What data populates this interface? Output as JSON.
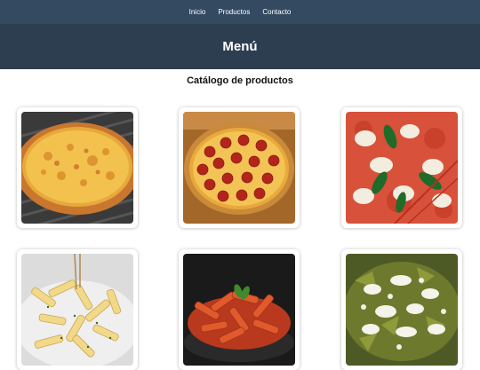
{
  "nav": {
    "items": [
      {
        "label": "Inicio"
      },
      {
        "label": "Productos"
      },
      {
        "label": "Contacto"
      }
    ]
  },
  "header": {
    "title": "Menú"
  },
  "catalog": {
    "title": "Catálogo de productos",
    "products": [
      {
        "icon": "cheese-pizza-image"
      },
      {
        "icon": "pepperoni-pizza-image"
      },
      {
        "icon": "margherita-pizza-image"
      },
      {
        "icon": "penne-alfredo-image"
      },
      {
        "icon": "penne-tomato-basil-image"
      },
      {
        "icon": "chilaquiles-verdes-image"
      }
    ]
  },
  "colors": {
    "nav_bg": "#334a60",
    "banner_bg": "#2e3e51",
    "text_light": "#ffffff",
    "text_dark": "#111111"
  }
}
